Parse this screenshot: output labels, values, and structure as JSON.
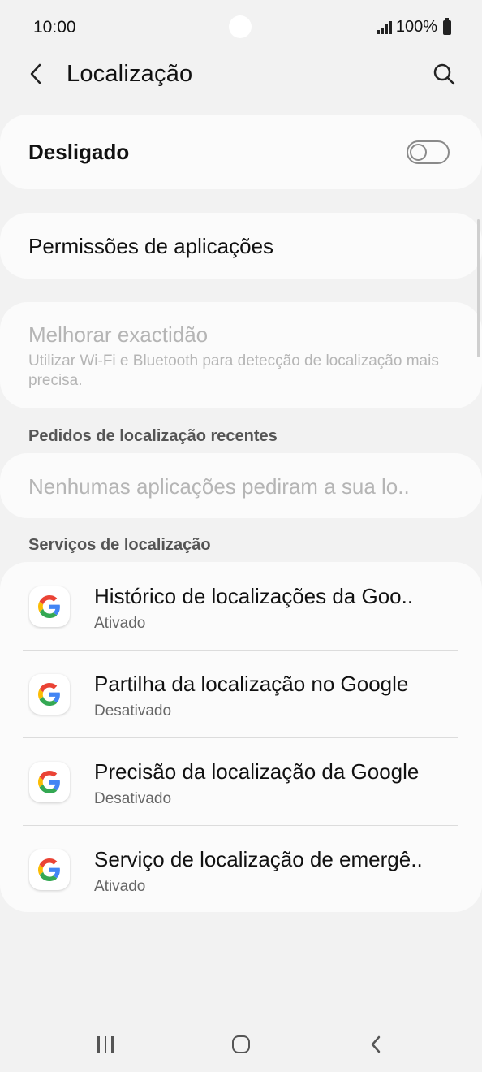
{
  "status": {
    "time": "10:00",
    "battery": "100%"
  },
  "header": {
    "title": "Localização"
  },
  "master_toggle": {
    "label": "Desligado",
    "on": false
  },
  "permissions": {
    "label": "Permissões de aplicações"
  },
  "accuracy": {
    "title": "Melhorar exactidão",
    "description": "Utilizar Wi-Fi e Bluetooth para detecção de localização mais precisa."
  },
  "recent": {
    "header": "Pedidos de localização recentes",
    "empty_text": "Nenhumas aplicações pediram a sua lo.."
  },
  "services": {
    "header": "Serviços de localização",
    "items": [
      {
        "title": "Histórico de localizações da Goo..",
        "status": "Ativado"
      },
      {
        "title": "Partilha da localização no Google",
        "status": "Desativado"
      },
      {
        "title": "Precisão da localização da Google",
        "status": "Desativado"
      },
      {
        "title": "Serviço de localização de emergê..",
        "status": "Ativado"
      }
    ]
  },
  "colors": {
    "background": "#f2f2f2",
    "card": "#fbfbfb",
    "disabled_text": "#b5b5b5"
  }
}
